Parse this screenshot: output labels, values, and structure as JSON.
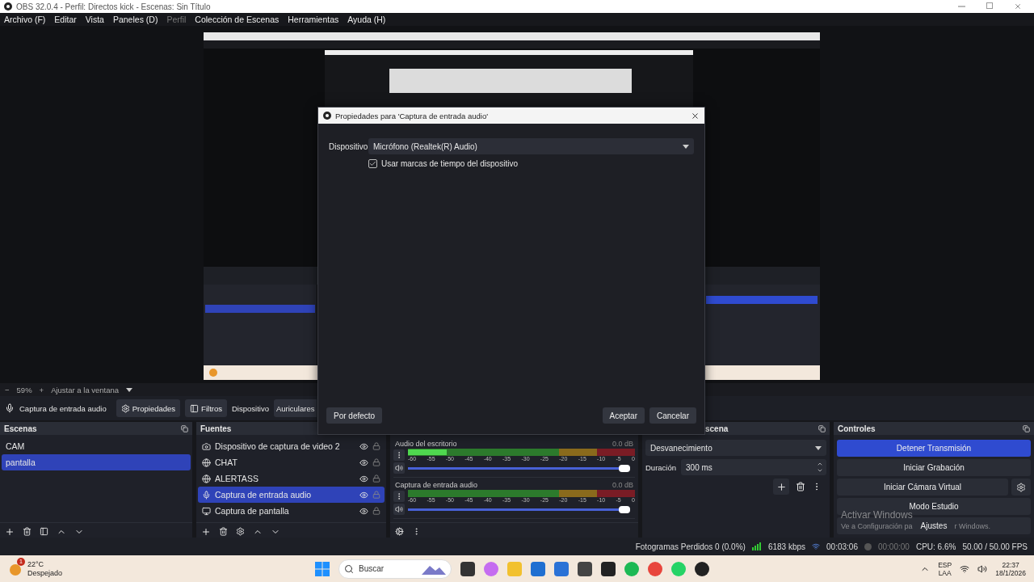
{
  "window": {
    "title": "OBS 32.0.4 - Perfil: Directos kick - Escenas: Sin Título"
  },
  "menu": [
    {
      "label": "Archivo (F)",
      "disabled": false
    },
    {
      "label": "Editar",
      "disabled": false
    },
    {
      "label": "Vista",
      "disabled": false
    },
    {
      "label": "Paneles (D)",
      "disabled": false
    },
    {
      "label": "Perfil",
      "disabled": true
    },
    {
      "label": "Colección de Escenas",
      "disabled": false
    },
    {
      "label": "Herramientas",
      "disabled": false
    },
    {
      "label": "Ayuda (H)",
      "disabled": false
    }
  ],
  "zoom_bar": {
    "minus": "−",
    "zoom": "59%",
    "plus": "+",
    "fit": "Ajustar a la ventana"
  },
  "source_toolbar": {
    "source": "Captura de entrada audio",
    "properties": "Propiedades",
    "filters": "Filtros",
    "device_label": "Dispositivo",
    "device_value": "Auriculares"
  },
  "scenes": {
    "title": "Escenas",
    "items": [
      {
        "label": "CAM",
        "selected": false
      },
      {
        "label": "pantalla",
        "selected": true
      }
    ]
  },
  "sources": {
    "title": "Fuentes",
    "items": [
      {
        "label": "Dispositivo de captura de video 2",
        "kind": "camera",
        "selected": false
      },
      {
        "label": "CHAT",
        "kind": "browser",
        "selected": false
      },
      {
        "label": "ALERTASS",
        "kind": "browser",
        "selected": false
      },
      {
        "label": "Captura de entrada audio",
        "kind": "audio",
        "selected": true
      },
      {
        "label": "Captura de pantalla",
        "kind": "display",
        "selected": false
      }
    ]
  },
  "mixer": {
    "channels": [
      {
        "name": "Audio del escritorio",
        "reading": "0.0 dB",
        "meter": {
          "level": 0.17
        },
        "volume": {
          "level": 1
        },
        "scale": [
          "-60",
          "-55",
          "-50",
          "-45",
          "-40",
          "-35",
          "-30",
          "-25",
          "-20",
          "-15",
          "-10",
          "-5",
          "0"
        ]
      },
      {
        "name": "Captura de entrada audio",
        "reading": "0.0 dB",
        "meter": {
          "level": 0
        },
        "volume": {
          "level": 1
        },
        "scale": [
          "-60",
          "-55",
          "-50",
          "-45",
          "-40",
          "-35",
          "-30",
          "-25",
          "-20",
          "-15",
          "-10",
          "-5",
          "0"
        ]
      }
    ]
  },
  "transitions": {
    "title": "scena",
    "transition": "Desvanecimiento",
    "duration_label": "Duración",
    "duration": "300 ms"
  },
  "controls": {
    "title": "Controles",
    "buttons": [
      {
        "label": "Detener Transmisión",
        "active": true,
        "kind": "plain"
      },
      {
        "label": "Iniciar Grabación",
        "active": false,
        "kind": "plain"
      },
      {
        "label": "Iniciar Cámara Virtual",
        "active": false,
        "kind": "gear"
      },
      {
        "label": "Modo Estudio",
        "active": false,
        "kind": "plain"
      },
      {
        "label": "Ajustes",
        "active": false,
        "kind": "plain"
      }
    ]
  },
  "activation_notice": {
    "title": "Activar Windows",
    "text_parts": [
      "Ve a Configuración pa",
      "r Windows."
    ]
  },
  "status_bar": {
    "dropped": "Fotogramas Perdidos 0 (0.0%)",
    "bitrate": "6183 kbps",
    "stream_time": "00:03:06",
    "record_time": "00:00:00",
    "cpu": "CPU: 6.6%",
    "fps": "50.00 / 50.00 FPS"
  },
  "dialog": {
    "title": "Propiedades para 'Captura de entrada audio'",
    "device_label": "Dispositivo",
    "device_value": "Micrófono (Realtek(R) Audio)",
    "checkbox": {
      "label": "Usar marcas de tiempo del dispositivo",
      "checked": true
    },
    "defaults": "Por defecto",
    "ok": "Aceptar",
    "cancel": "Cancelar"
  },
  "taskbar": {
    "weather": {
      "badge": "1",
      "temp": "22°C",
      "text": "Despejado"
    },
    "search": "Buscar",
    "tray": {
      "lang": "ESP",
      "layout": "LAA",
      "time": "22:37",
      "date": "18/1/2026"
    }
  }
}
